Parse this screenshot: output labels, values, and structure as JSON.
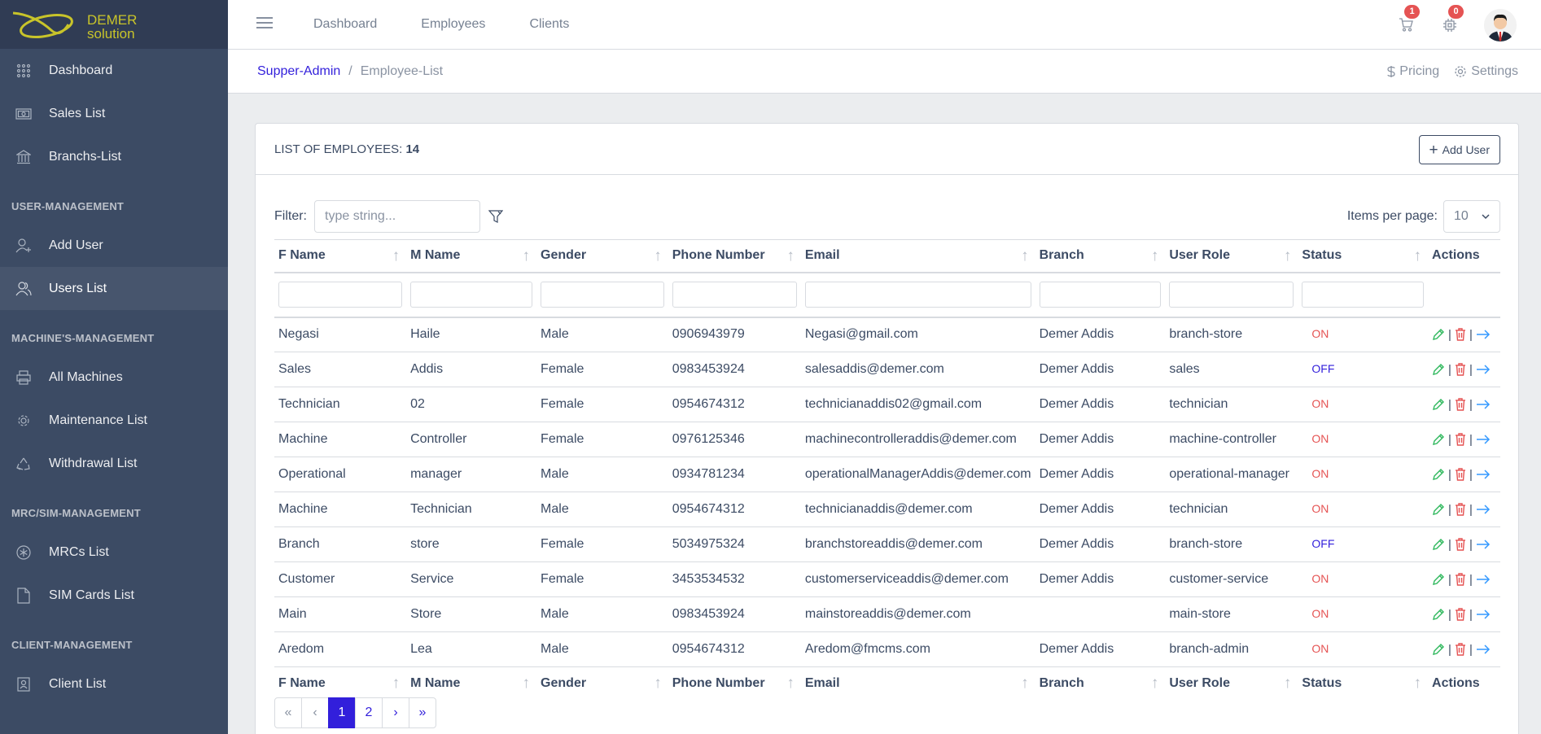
{
  "brand": {
    "line1": "DEMER",
    "line2": "solution",
    "logo_color": "#c8c42a"
  },
  "sidebar": {
    "items_top": [
      {
        "label": "Dashboard",
        "icon": "grid-icon"
      },
      {
        "label": "Sales List",
        "icon": "cash-icon"
      },
      {
        "label": "Branchs-List",
        "icon": "bank-icon"
      }
    ],
    "section_user": "USER-MANAGEMENT",
    "items_user": [
      {
        "label": "Add User",
        "icon": "user-plus-icon"
      },
      {
        "label": "Users List",
        "icon": "users-icon"
      }
    ],
    "section_machine": "MACHINE'S-MANAGEMENT",
    "items_machine": [
      {
        "label": "All Machines",
        "icon": "printer-icon"
      },
      {
        "label": "Maintenance List",
        "icon": "cog-icon"
      },
      {
        "label": "Withdrawal List",
        "icon": "recycle-icon"
      }
    ],
    "section_mrc": "MRC/SIM-MANAGEMENT",
    "items_mrc": [
      {
        "label": "MRCs List",
        "icon": "asterisk-icon"
      },
      {
        "label": "SIM Cards List",
        "icon": "file-icon"
      }
    ],
    "section_client": "CLIENT-MANAGEMENT",
    "items_client": [
      {
        "label": "Client List",
        "icon": "contacts-icon"
      }
    ]
  },
  "header": {
    "links": [
      "Dashboard",
      "Employees",
      "Clients"
    ],
    "cart_count": "1",
    "notif_count": "0"
  },
  "breadcrumb": {
    "root": "Supper-Admin",
    "current": "Employee-List"
  },
  "subheader_right": {
    "pricing": "Pricing",
    "settings": "Settings"
  },
  "card": {
    "title": "LIST OF EMPLOYEES:",
    "count": "14",
    "add_button": "Add User"
  },
  "filter": {
    "label": "Filter:",
    "placeholder": "type string..."
  },
  "items_per_page": {
    "label": "Items per page:",
    "value": "10"
  },
  "table": {
    "columns": [
      "F Name",
      "M Name",
      "Gender",
      "Phone Number",
      "Email",
      "Branch",
      "User Role",
      "Status",
      "Actions"
    ],
    "rows": [
      [
        "Negasi",
        "Haile",
        "Male",
        "0906943979",
        "Negasi@gmail.com",
        "Demer Addis",
        "branch-store",
        "ON"
      ],
      [
        "Sales",
        "Addis",
        "Female",
        "0983453924",
        "salesaddis@demer.com",
        "Demer Addis",
        "sales",
        "OFF"
      ],
      [
        "Technician",
        "02",
        "Female",
        "0954674312",
        "technicianaddis02@gmail.com",
        "Demer Addis",
        "technician",
        "ON"
      ],
      [
        "Machine",
        "Controller",
        "Female",
        "0976125346",
        "machinecontrolleraddis@demer.com",
        "Demer Addis",
        "machine-controller",
        "ON"
      ],
      [
        "Operational",
        "manager",
        "Male",
        "0934781234",
        "operationalManagerAddis@demer.com",
        "Demer Addis",
        "operational-manager",
        "ON"
      ],
      [
        "Machine",
        "Technician",
        "Male",
        "0954674312",
        "technicianaddis@demer.com",
        "Demer Addis",
        "technician",
        "ON"
      ],
      [
        "Branch",
        "store",
        "Female",
        "5034975324",
        "branchstoreaddis@demer.com",
        "Demer Addis",
        "branch-store",
        "OFF"
      ],
      [
        "Customer",
        "Service",
        "Female",
        "3453534532",
        "customerserviceaddis@demer.com",
        "Demer Addis",
        "customer-service",
        "ON"
      ],
      [
        "Main",
        "Store",
        "Male",
        "0983453924",
        "mainstoreaddis@demer.com",
        "",
        "main-store",
        "ON"
      ],
      [
        "Aredom",
        "Lea",
        "Male",
        "0954674312",
        "Aredom@fmcms.com",
        "Demer Addis",
        "branch-admin",
        "ON"
      ]
    ]
  },
  "pagination": {
    "first": "«",
    "prev": "‹",
    "pages": [
      "1",
      "2"
    ],
    "active": "1",
    "next": "›",
    "last": "»"
  },
  "colors": {
    "sidebar": "#3c4b64",
    "primary": "#321fdb",
    "danger": "#e55353",
    "success": "#2eb85c",
    "info": "#39f"
  }
}
